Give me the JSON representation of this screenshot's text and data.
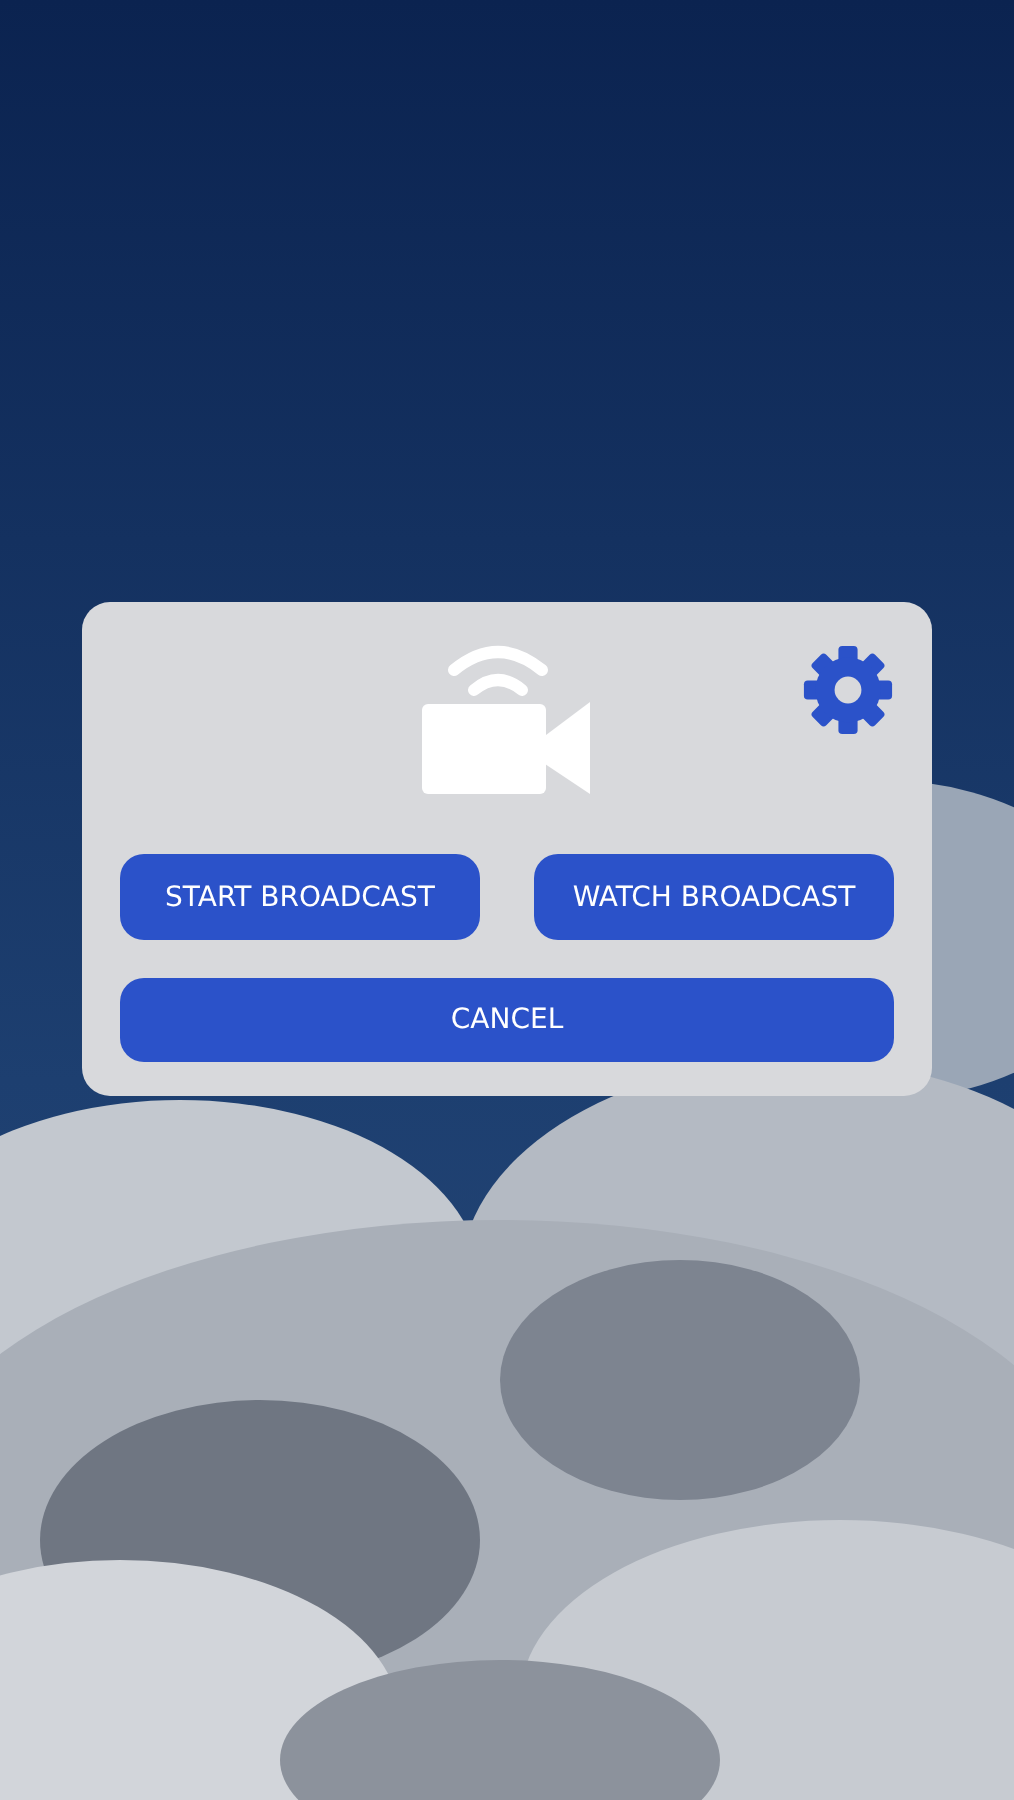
{
  "actions": [
    {
      "label": "START BROADCAST"
    },
    {
      "label": "WATCH BROADCAST"
    }
  ],
  "cancel": {
    "label": "CANCEL"
  }
}
